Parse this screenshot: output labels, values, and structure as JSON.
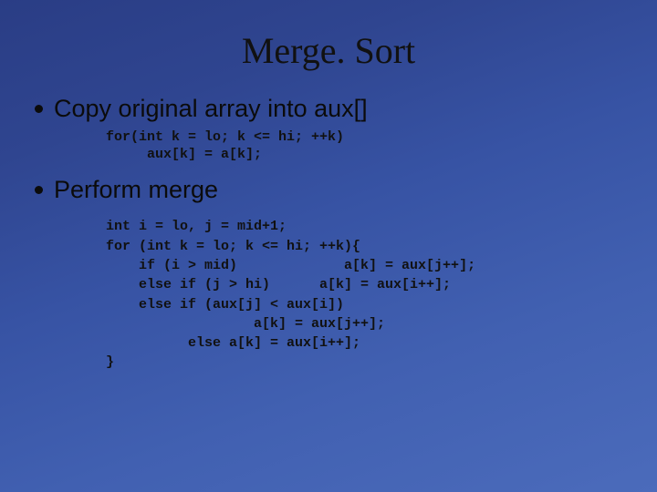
{
  "title": "Merge. Sort",
  "bullets": [
    "Copy original array into aux[]",
    "Perform merge"
  ],
  "code_copy": "for(int k = lo; k <= hi; ++k)\n     aux[k] = a[k];",
  "code_merge": "int i = lo, j = mid+1;\nfor (int k = lo; k <= hi; ++k){\n    if (i > mid)             a[k] = aux[j++];\n    else if (j > hi)      a[k] = aux[i++];\n    else if (aux[j] < aux[i])\n                  a[k] = aux[j++];\n          else a[k] = aux[i++];\n}"
}
